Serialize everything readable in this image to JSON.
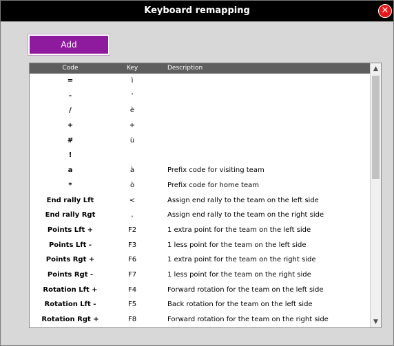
{
  "window": {
    "title": "Keyboard remapping",
    "close_label": "✕"
  },
  "toolbar": {
    "add_label": "Add"
  },
  "table": {
    "columns": {
      "code": "Code",
      "key": "Key",
      "description": "Description"
    },
    "rows": [
      {
        "code": "=",
        "key": "ì",
        "description": ""
      },
      {
        "code": "-",
        "key": "'",
        "description": ""
      },
      {
        "code": "/",
        "key": "è",
        "description": ""
      },
      {
        "code": "+",
        "key": "+",
        "description": ""
      },
      {
        "code": "#",
        "key": "ù",
        "description": ""
      },
      {
        "code": "!",
        "key": "",
        "description": ""
      },
      {
        "code": "a",
        "key": "à",
        "description": "Prefix code for visiting team"
      },
      {
        "code": "*",
        "key": "ò",
        "description": "Prefix code for home team"
      },
      {
        "code": "End rally Lft",
        "key": "<",
        "description": "Assign end rally to the team on the left side"
      },
      {
        "code": "End rally Rgt",
        "key": ",",
        "description": "Assign end rally to the team on the right side"
      },
      {
        "code": "Points Lft +",
        "key": "F2",
        "description": "1 extra point for the team on the left side"
      },
      {
        "code": "Points Lft -",
        "key": "F3",
        "description": "1 less point for the team on the left side"
      },
      {
        "code": "Points Rgt +",
        "key": "F6",
        "description": "1 extra point for the team on the right side"
      },
      {
        "code": "Points Rgt -",
        "key": "F7",
        "description": "1 less point for the team on the right side"
      },
      {
        "code": "Rotation Lft +",
        "key": "F4",
        "description": "Forward rotation for the team on the left side"
      },
      {
        "code": "Rotation Lft -",
        "key": "F5",
        "description": "Back rotation for the team on the left side"
      },
      {
        "code": "Rotation Rgt +",
        "key": "F8",
        "description": "Forward rotation for the team on the right side"
      }
    ]
  },
  "scrollbar": {
    "up_icon": "▲",
    "down_icon": "▼"
  }
}
